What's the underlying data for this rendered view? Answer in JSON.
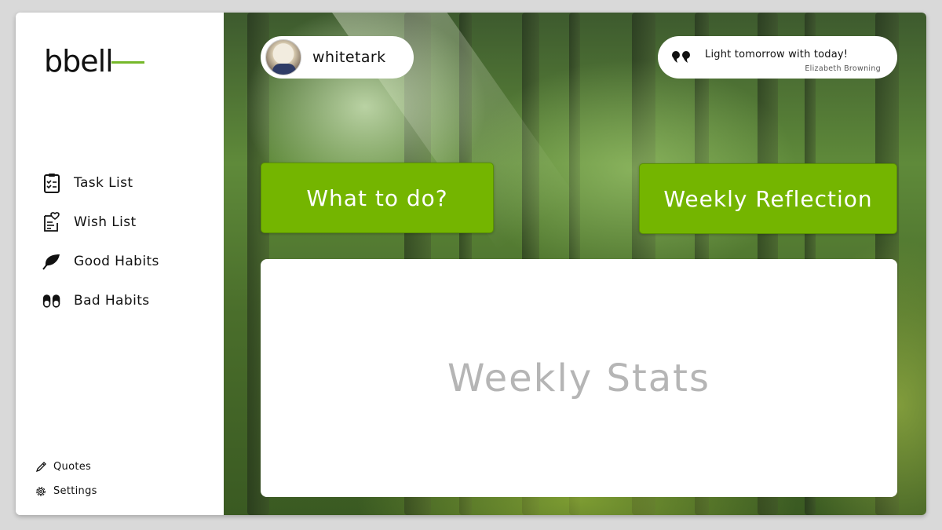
{
  "app": {
    "logo_text": "bbell"
  },
  "sidebar": {
    "items": [
      {
        "label": "Task List",
        "icon": "clipboard-checklist-icon"
      },
      {
        "label": "Wish List",
        "icon": "heart-list-icon"
      },
      {
        "label": "Good Habits",
        "icon": "leaf-icon"
      },
      {
        "label": "Bad Habits",
        "icon": "pills-icon"
      }
    ],
    "bottom_items": [
      {
        "label": "Quotes",
        "icon": "pencil-icon"
      },
      {
        "label": "Settings",
        "icon": "gear-icon"
      }
    ]
  },
  "header": {
    "username": "whitetark",
    "quote_text": "Light tomorrow with today!",
    "quote_author": "Elizabeth Browning"
  },
  "actions": {
    "what_to_do_label": "What to do?",
    "weekly_reflection_label": "Weekly Reflection"
  },
  "stats": {
    "title": "Weekly Stats"
  },
  "colors": {
    "accent": "#74b500",
    "logo_accent": "#76b82a",
    "stats_title": "#b5b5b5"
  }
}
